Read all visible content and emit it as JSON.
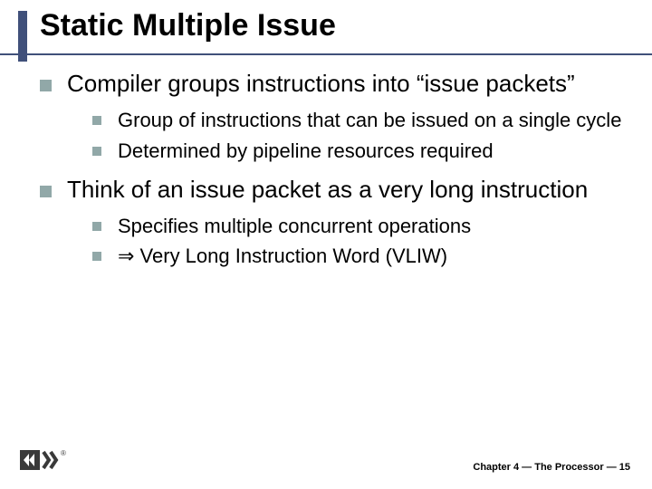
{
  "title": "Static Multiple Issue",
  "bullets": [
    {
      "text": "Compiler groups instructions into “issue packets”",
      "children": [
        "Group of instructions that can be issued on a single cycle",
        "Determined by pipeline resources required"
      ]
    },
    {
      "text": "Think of an issue packet as a very long instruction",
      "children": [
        "Specifies multiple concurrent operations",
        "⇒ Very Long Instruction Word (VLIW)"
      ]
    }
  ],
  "footer": "Chapter 4 — The Processor — 15"
}
